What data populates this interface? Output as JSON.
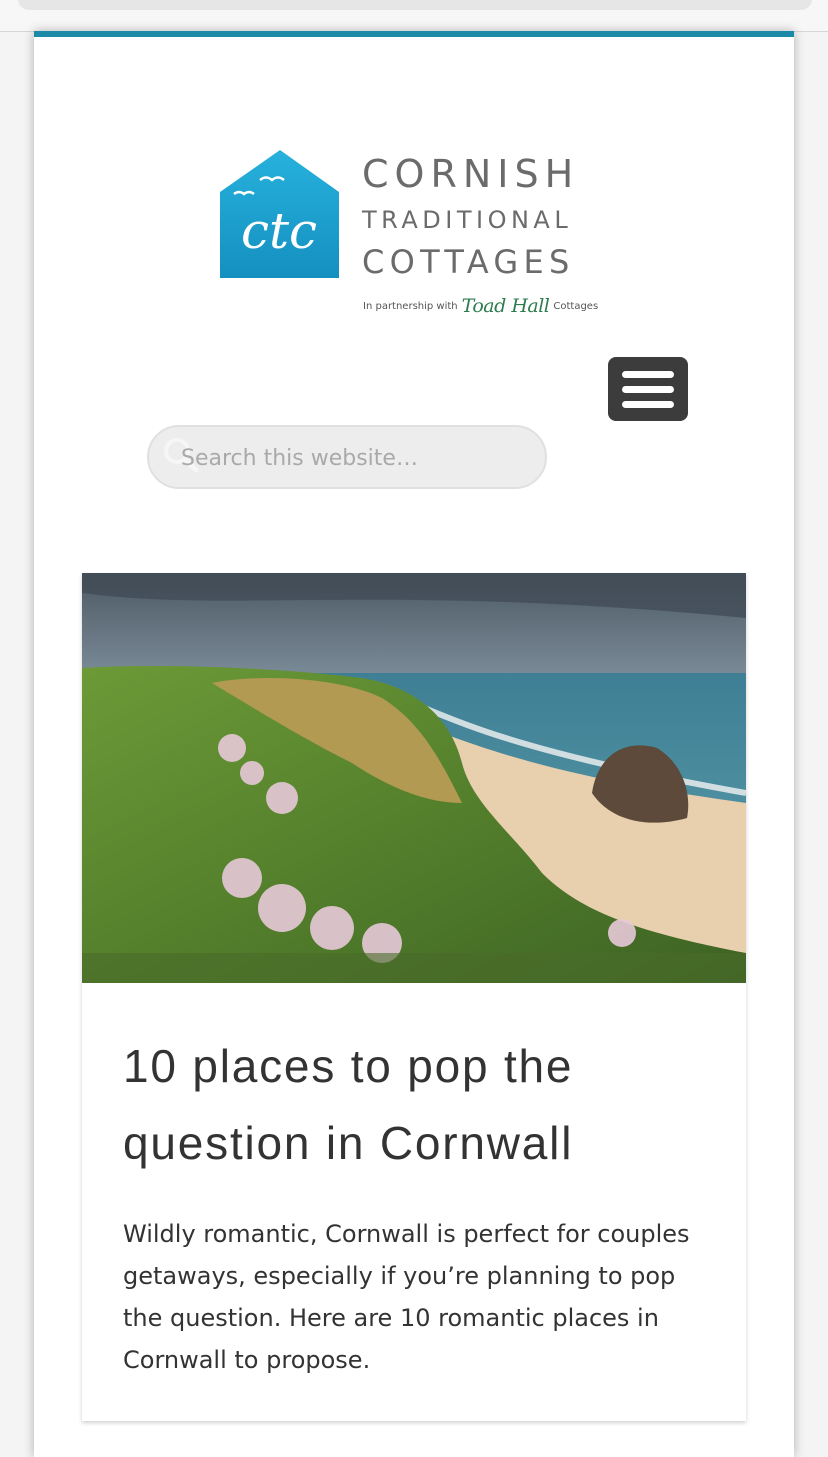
{
  "brand": {
    "logo_initials": "ctc",
    "name_line1": "CORNISH",
    "name_line2": "TRADITIONAL",
    "name_line3": "COTTAGES",
    "partner_prefix": "In partnership with",
    "partner_name": "Toad Hall",
    "partner_suffix": "Cottages",
    "colors": {
      "logo_blue": "#1fa3cf",
      "accent_teal": "#1a8aa6",
      "partner_green": "#2e7d4f"
    }
  },
  "header": {
    "menu_icon": "hamburger-menu-icon",
    "search": {
      "placeholder": "Search this website…",
      "value": "",
      "icon": "search-icon"
    }
  },
  "post": {
    "image": "cliff-beach-photo",
    "title": "10 places to pop the question in Cornwall",
    "excerpt": "Wildly romantic, Cornwall is perfect for couples getaways, especially if you’re planning to pop the question. Here are 10 romantic places in Cornwall to propose."
  }
}
